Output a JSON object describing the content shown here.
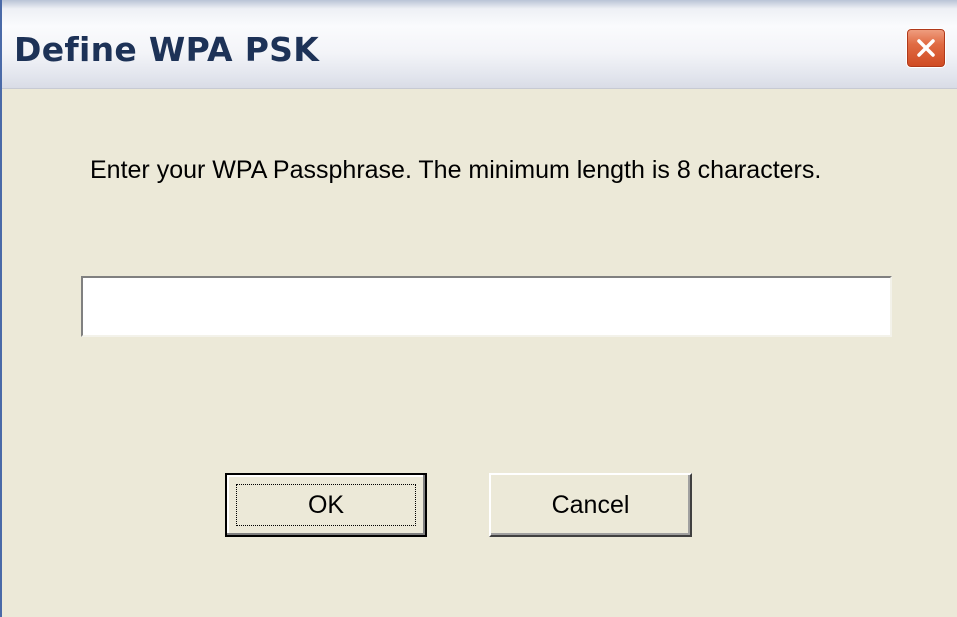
{
  "dialog": {
    "title": "Define WPA PSK",
    "close_icon": "close-icon",
    "prompt": "Enter your WPA Passphrase.  The minimum length is 8 characters.",
    "passphrase_value": "",
    "ok_label": "OK",
    "cancel_label": "Cancel"
  },
  "colors": {
    "window_bg": "#ece9d8",
    "title_text": "#1d3257",
    "close_button": "#e06b43"
  }
}
